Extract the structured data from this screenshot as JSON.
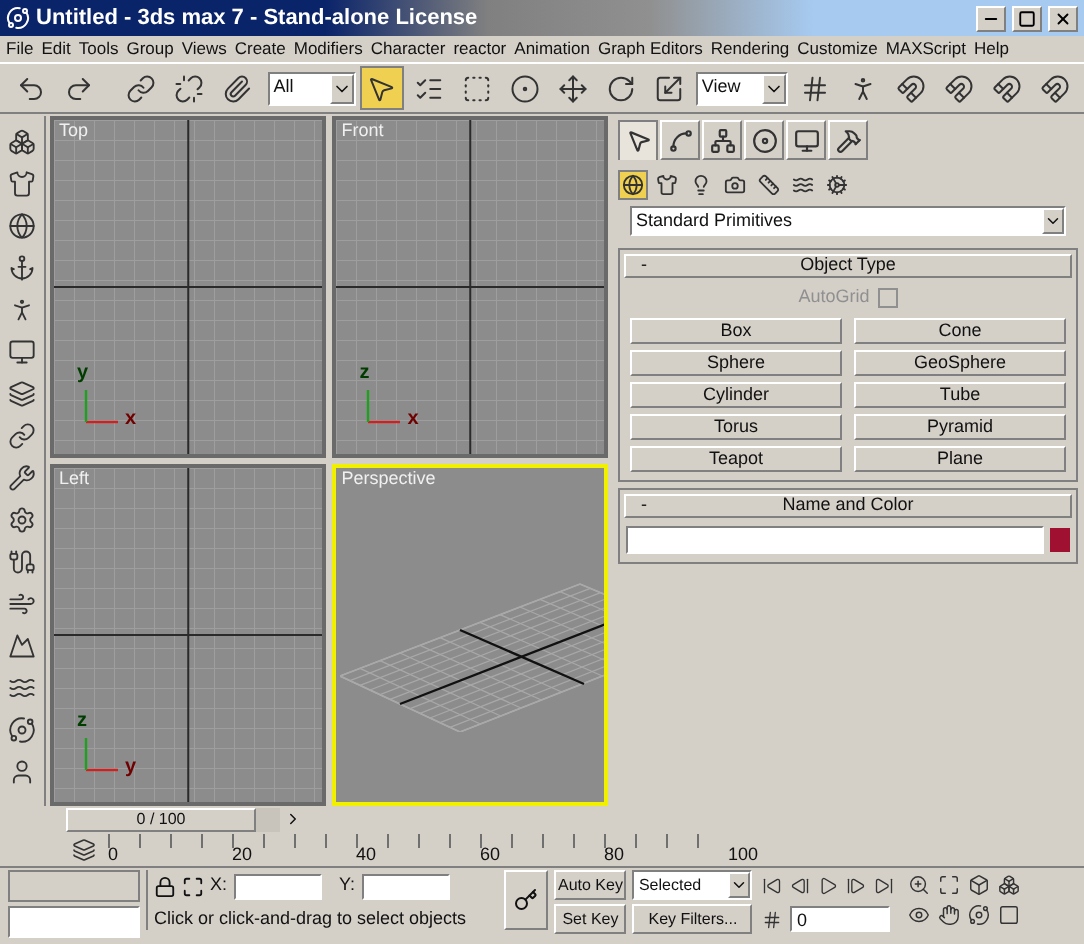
{
  "window": {
    "title": "Untitled - 3ds max 7 - Stand-alone License"
  },
  "menu": [
    "File",
    "Edit",
    "Tools",
    "Group",
    "Views",
    "Create",
    "Modifiers",
    "Character",
    "reactor",
    "Animation",
    "Graph Editors",
    "Rendering",
    "Customize",
    "MAXScript",
    "Help"
  ],
  "toolbar": {
    "selection_filter": "All",
    "reference_coordinates": "View",
    "select_tool_active": true
  },
  "viewports": [
    {
      "label": "Top",
      "kind": "ortho",
      "active": false,
      "axes": [
        "x",
        "y"
      ]
    },
    {
      "label": "Front",
      "kind": "ortho",
      "active": false,
      "axes": [
        "x",
        "z"
      ]
    },
    {
      "label": "Left",
      "kind": "ortho",
      "active": false,
      "axes": [
        "y",
        "z"
      ]
    },
    {
      "label": "Perspective",
      "kind": "perspective",
      "active": true
    }
  ],
  "command_panel": {
    "tabs": [
      {
        "kind": "create",
        "selected": true
      },
      {
        "kind": "modify",
        "selected": false
      },
      {
        "kind": "hierarchy",
        "selected": false
      },
      {
        "kind": "motion",
        "selected": false
      },
      {
        "kind": "display",
        "selected": false
      },
      {
        "kind": "utilities",
        "selected": false
      }
    ],
    "categories": [
      {
        "kind": "geometry",
        "selected": true
      },
      {
        "kind": "shapes",
        "selected": false
      },
      {
        "kind": "lights",
        "selected": false
      },
      {
        "kind": "cameras",
        "selected": false
      },
      {
        "kind": "helpers",
        "selected": false
      },
      {
        "kind": "spacewarps",
        "selected": false
      },
      {
        "kind": "systems",
        "selected": false
      }
    ],
    "object_category": "Standard Primitives",
    "object_type": {
      "toggle": "-",
      "title": "Object Type",
      "autogrid": {
        "label": "AutoGrid",
        "checked": false,
        "disabled": true
      },
      "buttons": [
        "Box",
        "Cone",
        "Sphere",
        "GeoSphere",
        "Cylinder",
        "Tube",
        "Torus",
        "Pyramid",
        "Teapot",
        "Plane"
      ]
    },
    "name_and_color": {
      "toggle": "-",
      "title": "Name and Color",
      "color": "#a01030"
    }
  },
  "time_slider": {
    "label": "0 / 100"
  },
  "track_bar": {
    "ticks": [
      "0",
      "20",
      "40",
      "60",
      "80",
      "100"
    ]
  },
  "status": {
    "x_label": "X:",
    "y_label": "Y:",
    "prompt": "Click or click-and-drag to select objects"
  },
  "animation": {
    "auto_key": "Auto Key",
    "set_key": "Set Key",
    "key_mode": "Selected",
    "key_filters": "Key Filters...",
    "current_frame": "0"
  }
}
